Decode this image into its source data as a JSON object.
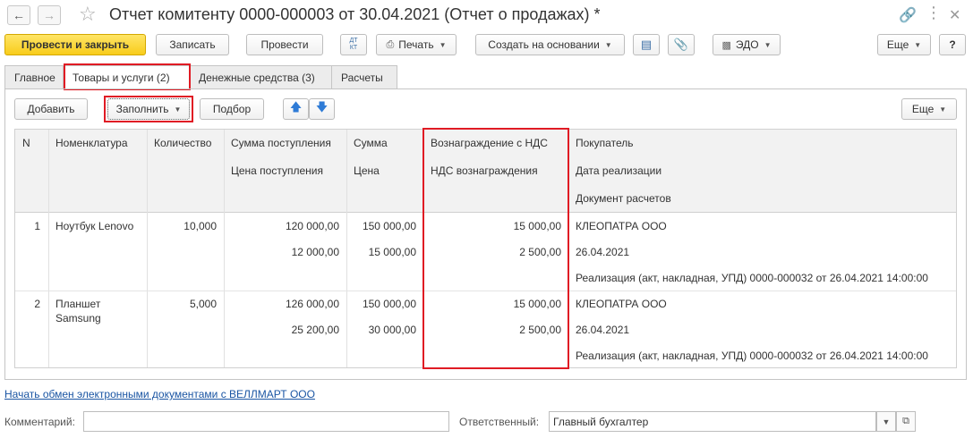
{
  "window": {
    "title": "Отчет комитенту 0000-000003 от 30.04.2021 (Отчет о продажах) *"
  },
  "toolbar": {
    "post_close": "Провести и закрыть",
    "save": "Записать",
    "post": "Провести",
    "dtkt": "ДТ КТ",
    "print": "Печать",
    "create_based": "Создать на основании",
    "edo": "ЭДО",
    "more": "Еще",
    "help": "?"
  },
  "tabs": [
    {
      "label": "Главное"
    },
    {
      "label": "Товары и услуги (2)"
    },
    {
      "label": "Денежные средства (3)"
    },
    {
      "label": "Расчеты"
    }
  ],
  "table_toolbar": {
    "add": "Добавить",
    "fill": "Заполнить",
    "select": "Подбор",
    "more": "Еще"
  },
  "table": {
    "headers": {
      "n": "N",
      "nomenclature": "Номенклатура",
      "quantity": "Количество",
      "receipt_sum": "Сумма поступления",
      "receipt_price": "Цена поступления",
      "sum": "Сумма",
      "price": "Цена",
      "reward_vat": "Вознаграждение с НДС",
      "reward_vat_amount": "НДС вознаграждения",
      "buyer": "Покупатель",
      "sale_date": "Дата реализации",
      "settlement_doc": "Документ расчетов"
    },
    "rows": [
      {
        "n": "1",
        "nomenclature": "Ноутбук Lenovo",
        "quantity": "10,000",
        "receipt_sum": "120 000,00",
        "receipt_price": "12 000,00",
        "sum": "150 000,00",
        "price": "15 000,00",
        "reward_vat": "15 000,00",
        "reward_vat_amount": "2 500,00",
        "buyer": "КЛЕОПАТРА ООО",
        "sale_date": "26.04.2021",
        "settlement_doc": "Реализация (акт, накладная, УПД) 0000-000032 от 26.04.2021 14:00:00"
      },
      {
        "n": "2",
        "nomenclature_line1": "Планшет",
        "nomenclature_line2": "Samsung",
        "quantity": "5,000",
        "receipt_sum": "126 000,00",
        "receipt_price": "25 200,00",
        "sum": "150 000,00",
        "price": "30 000,00",
        "reward_vat": "15 000,00",
        "reward_vat_amount": "2 500,00",
        "buyer": "КЛЕОПАТРА ООО",
        "sale_date": "26.04.2021",
        "settlement_doc": "Реализация (акт, накладная, УПД) 0000-000032 от 26.04.2021 14:00:00"
      }
    ]
  },
  "footer": {
    "edo_link": "Начать обмен электронными документами с ВЕЛЛМАРТ ООО",
    "comment_label": "Комментарий:",
    "comment_value": "",
    "responsible_label": "Ответственный:",
    "responsible_value": "Главный бухгалтер"
  },
  "colors": {
    "highlight": "#e01b24",
    "primary_button": "#f8cc1b",
    "link": "#1a55a3"
  }
}
